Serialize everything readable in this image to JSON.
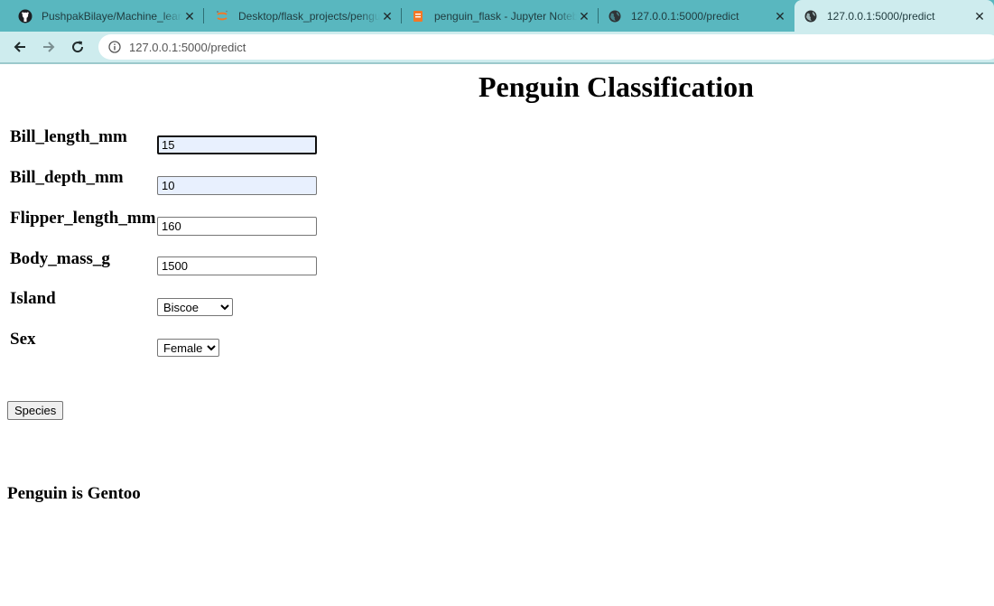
{
  "browser": {
    "tabs": [
      {
        "title": "PushpakBilaye/Machine_learning",
        "icon": "github-icon",
        "active": false
      },
      {
        "title": "Desktop/flask_projects/penguin",
        "icon": "jupyter-icon",
        "active": false
      },
      {
        "title": "penguin_flask - Jupyter Notebook",
        "icon": "notebook-icon",
        "active": false
      },
      {
        "title": "127.0.0.1:5000/predict",
        "icon": "globe-icon",
        "active": false
      },
      {
        "title": "127.0.0.1:5000/predict",
        "icon": "globe-icon",
        "active": true
      }
    ],
    "url": "127.0.0.1:5000/predict",
    "theme_color": "#59b7bf",
    "toolbar_color": "#ceecee"
  },
  "page": {
    "title": "Penguin Classification",
    "form": {
      "bill_length": {
        "label": "Bill_length_mm",
        "value": "15"
      },
      "bill_depth": {
        "label": "Bill_depth_mm",
        "value": "10"
      },
      "flipper_length": {
        "label": "Flipper_length_mm",
        "value": "160"
      },
      "body_mass": {
        "label": "Body_mass_g",
        "value": "1500"
      },
      "island": {
        "label": "Island",
        "selected": "Biscoe"
      },
      "sex": {
        "label": "Sex",
        "selected": "Female"
      },
      "submit_label": "Species"
    },
    "result": "Penguin is Gentoo"
  }
}
